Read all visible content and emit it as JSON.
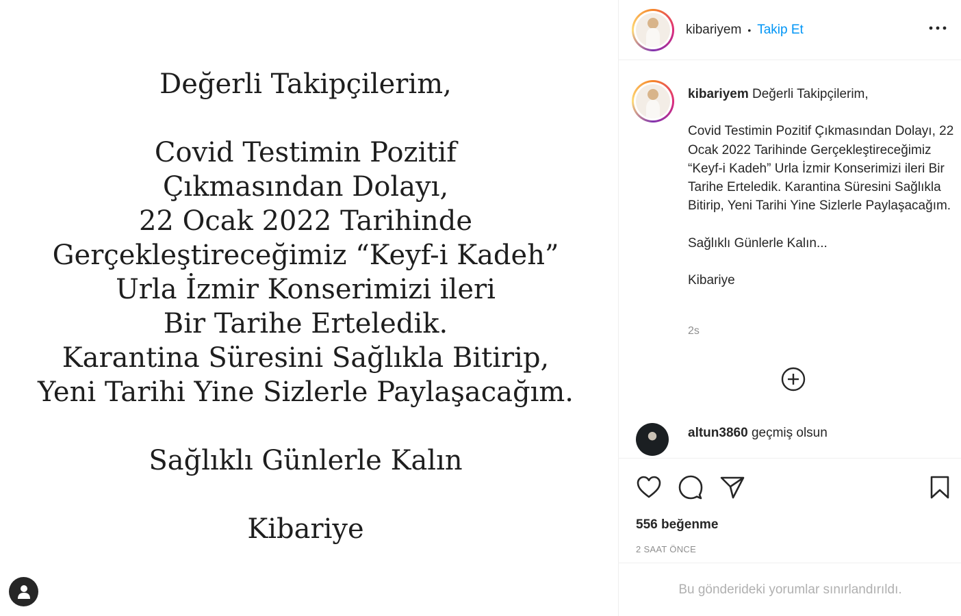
{
  "post": {
    "letter": {
      "greeting": "Değerli Takipçilerim,",
      "body_lines": [
        "Covid Testimin Pozitif",
        "Çıkmasından Dolayı,",
        "22 Ocak 2022 Tarihinde",
        "Gerçekleştireceğimiz “Keyf-i Kadeh”",
        "Urla İzmir Konserimizi ileri",
        "Bir Tarihe Erteledik.",
        "Karantina Süresini Sağlıkla Bitirip,",
        "Yeni Tarihi Yine Sizlerle Paylaşacağım."
      ],
      "closing": "Sağlıklı Günlerle Kalın",
      "signature": "Kibariye"
    },
    "user_tag_icon": "person-icon"
  },
  "header": {
    "username": "kibariyem",
    "separator": "•",
    "follow_label": "Takip Et",
    "more_icon": "more-horizontal-icon"
  },
  "caption": {
    "username": "kibariyem",
    "first_line": "Değerli Takipçilerim,",
    "paragraph": "Covid Testimin Pozitif Çıkmasından Dolayı, 22 Ocak 2022 Tarihinde Gerçekleştireceğimiz “Keyf-i Kadeh” Urla İzmir Konserimizi ileri Bir Tarihe Erteledik. Karantina Süresini Sağlıkla Bitirip, Yeni Tarihi Yine Sizlerle Paylaşacağım.",
    "closing": "Sağlıklı Günlerle Kalın...",
    "signature": "Kibariye",
    "time": "2s"
  },
  "load_more_icon": "plus-circle-icon",
  "comments": [
    {
      "username": "altun3860",
      "text": "geçmiş olsun"
    }
  ],
  "actions": {
    "icons": [
      "heart-icon",
      "comment-icon",
      "share-icon",
      "bookmark-icon"
    ],
    "likes": "556 beğenme",
    "time_ago": "2 SAAT ÖNCE"
  },
  "comments_restricted": "Bu gönderideki yorumlar sınırlandırıldı.",
  "colors": {
    "link_blue": "#0095f6",
    "text": "#262626",
    "muted": "#8e8e8e",
    "border": "#efefef"
  }
}
